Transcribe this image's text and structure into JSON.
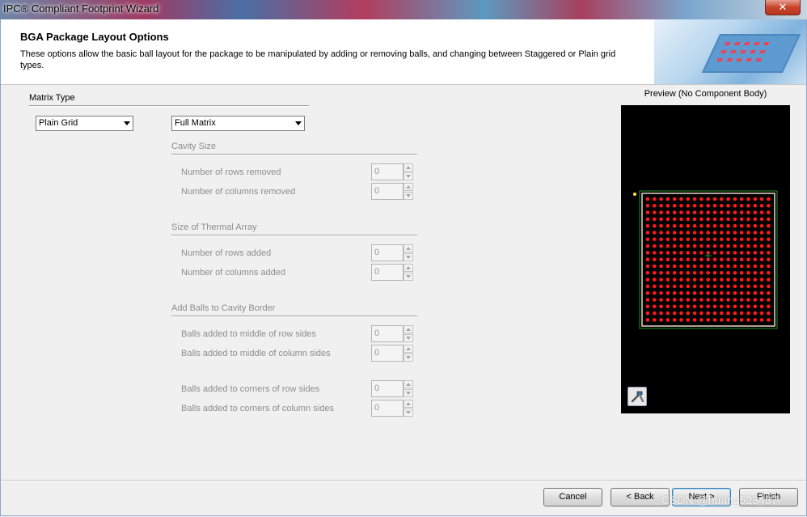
{
  "window": {
    "title": "IPC® Compliant Footprint Wizard",
    "close_label": "✕"
  },
  "header": {
    "title": "BGA Package Layout Options",
    "description": "These options allow the basic ball layout for the package to be manipulated by adding or removing balls, and changing between Staggered or Plain grid types."
  },
  "matrix_type": {
    "label": "Matrix Type",
    "grid_select": "Plain Grid",
    "matrix_select": "Full Matrix"
  },
  "cavity_size": {
    "label": "Cavity Size",
    "rows_removed": {
      "label": "Number of rows removed",
      "value": "0"
    },
    "cols_removed": {
      "label": "Number of columns removed",
      "value": "0"
    }
  },
  "thermal_array": {
    "label": "Size of Thermal Array",
    "rows_added": {
      "label": "Number of rows added",
      "value": "0"
    },
    "cols_added": {
      "label": "Number of columns added",
      "value": "0"
    }
  },
  "cavity_border": {
    "label": "Add Balls to Cavity Border",
    "middle_row": {
      "label": "Balls added to middle of row sides",
      "value": "0"
    },
    "middle_col": {
      "label": "Balls added to middle of column sides",
      "value": "0"
    },
    "corner_row": {
      "label": "Balls added to corners of row sides",
      "value": "0"
    },
    "corner_col": {
      "label": "Balls added to corners of column sides",
      "value": "0"
    }
  },
  "preview": {
    "title": "Preview (No Component Body)",
    "ball_color": "#ff1a1a",
    "outline_color": "#2e8b2e",
    "background": "#000000",
    "tool_icon": "wrench-hammer-icon"
  },
  "buttons": {
    "cancel": "Cancel",
    "back": "< Back",
    "next": "Next >",
    "finish": "Finish"
  },
  "watermark": "CSDN @huang523437"
}
